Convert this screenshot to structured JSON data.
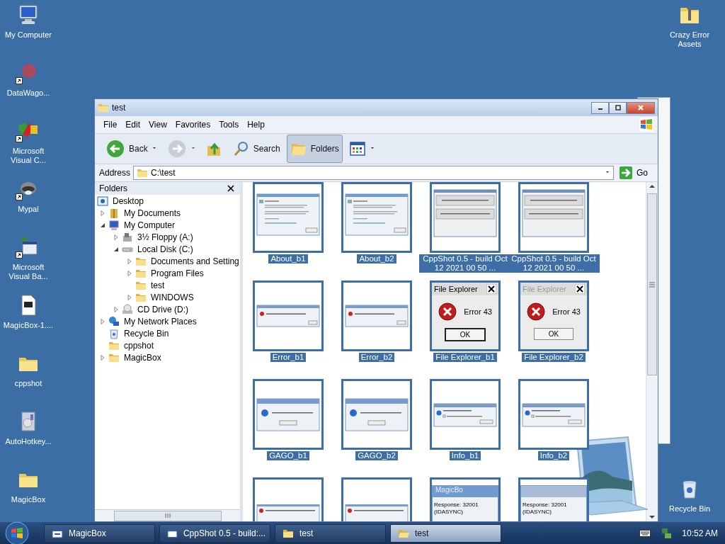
{
  "desktop": {
    "left_icons": [
      {
        "kind": "computer",
        "label": "My Computer",
        "shortcut": false
      },
      {
        "kind": "red-blob",
        "label": "DataWago...",
        "shortcut": true
      },
      {
        "kind": "visual-c",
        "label": "Microsoft Visual C...",
        "shortcut": true
      },
      {
        "kind": "animal",
        "label": "Mypal",
        "shortcut": true
      },
      {
        "kind": "visual-basic",
        "label": "Microsoft Visual Ba...",
        "shortcut": true
      },
      {
        "kind": "archive",
        "label": "MagicBox-1....",
        "shortcut": false
      },
      {
        "kind": "folder",
        "label": "cppshot",
        "shortcut": false
      },
      {
        "kind": "installer",
        "label": "AutoHotkey...",
        "shortcut": false
      },
      {
        "kind": "folder",
        "label": "MagicBox",
        "shortcut": false
      }
    ],
    "right_icons": [
      {
        "kind": "zip-folder",
        "label": "Crazy Error Assets"
      },
      {
        "kind": "recycle-bin",
        "label": "Recycle Bin"
      }
    ]
  },
  "explorer": {
    "title": "test",
    "menu": [
      "File",
      "Edit",
      "View",
      "Favorites",
      "Tools",
      "Help"
    ],
    "toolbar": [
      {
        "kind": "back",
        "label": "Back",
        "dropdown": true,
        "pressed": false,
        "disabled": false
      },
      {
        "kind": "forward",
        "dropdown": true,
        "pressed": false,
        "disabled": true
      },
      {
        "kind": "up",
        "dropdown": false,
        "pressed": false,
        "disabled": false
      },
      {
        "kind": "search",
        "label": "Search",
        "dropdown": false,
        "pressed": false,
        "disabled": false
      },
      {
        "kind": "folders",
        "label": "Folders",
        "dropdown": false,
        "pressed": true,
        "disabled": false
      },
      {
        "kind": "views",
        "dropdown": true,
        "pressed": false,
        "disabled": false
      }
    ],
    "address": {
      "label": "Address",
      "value": "C:\\test",
      "go": "Go"
    },
    "folders": {
      "title": "Folders",
      "tree": [
        {
          "kind": "desktop",
          "label": "Desktop",
          "children": [
            {
              "kind": "documents",
              "label": "My Documents",
              "expanded": false
            },
            {
              "kind": "computer",
              "label": "My Computer",
              "expanded": true,
              "children": [
                {
                  "kind": "floppy",
                  "label": "3½ Floppy (A:)",
                  "expanded": false
                },
                {
                  "kind": "disk",
                  "label": "Local Disk (C:)",
                  "expanded": true,
                  "children": [
                    {
                      "kind": "folder",
                      "label": "Documents and Setting",
                      "expanded": false
                    },
                    {
                      "kind": "folder",
                      "label": "Program Files",
                      "expanded": false
                    },
                    {
                      "kind": "folder",
                      "label": "test"
                    },
                    {
                      "kind": "folder",
                      "label": "WINDOWS",
                      "expanded": false
                    }
                  ]
                },
                {
                  "kind": "cd",
                  "label": "CD Drive (D:)",
                  "expanded": false
                }
              ]
            },
            {
              "kind": "network",
              "label": "My Network Places",
              "expanded": false
            },
            {
              "kind": "recycle",
              "label": "Recycle Bin"
            },
            {
              "kind": "folder",
              "label": "cppshot"
            },
            {
              "kind": "folder",
              "label": "MagicBox",
              "expanded": false
            }
          ]
        }
      ]
    },
    "thumbnails": [
      {
        "kind": "about",
        "label": "About_b1",
        "selected": true
      },
      {
        "kind": "about",
        "label": "About_b2",
        "selected": true
      },
      {
        "kind": "cppshot",
        "label": "CppShot 0.5 - build Oct 12 2021 00 50 ...",
        "selected": true
      },
      {
        "kind": "cppshot",
        "label": "CppShot 0.5 - build Oct 12 2021 00 50 ...",
        "selected": true
      },
      {
        "kind": "error",
        "label": "Error_b1",
        "selected": true
      },
      {
        "kind": "error",
        "label": "Error_b2",
        "selected": true
      },
      {
        "kind": "file-explorer",
        "label": "File Explorer_b1",
        "selected": true,
        "dialog": {
          "title": "File Explorer",
          "message": "Error 43",
          "button": "OK",
          "active": true
        }
      },
      {
        "kind": "file-explorer",
        "label": "File Explorer_b2",
        "selected": true,
        "dialog": {
          "title": "File Explorer",
          "message": "Error 43",
          "button": "OK",
          "active": false
        }
      },
      {
        "kind": "gago",
        "label": "GAGO_b1",
        "selected": true
      },
      {
        "kind": "gago",
        "label": "GAGO_b2",
        "selected": true
      },
      {
        "kind": "info",
        "label": "Info_b1",
        "selected": true
      },
      {
        "kind": "info",
        "label": "Info_b2",
        "selected": true
      },
      {
        "kind": "warning",
        "selected": true
      },
      {
        "kind": "warning",
        "selected": true
      },
      {
        "kind": "response",
        "selected": true,
        "dialog": {
          "title": "MagicBo",
          "message": "Response: 32001 (IDASYNC)",
          "active": true
        }
      },
      {
        "kind": "response",
        "selected": true,
        "dialog": {
          "message": "Response: 32001 (IDASYNC)",
          "active": false
        }
      }
    ]
  },
  "taskbar": {
    "tasks": [
      {
        "kind": "app",
        "label": "MagicBox",
        "selected": false
      },
      {
        "kind": "window",
        "label": "CppShot 0.5 - build:...",
        "selected": false
      },
      {
        "kind": "folder",
        "label": "test",
        "selected": false
      },
      {
        "kind": "folder-open",
        "label": "test",
        "selected": true
      }
    ],
    "clock": "10:52 AM"
  }
}
